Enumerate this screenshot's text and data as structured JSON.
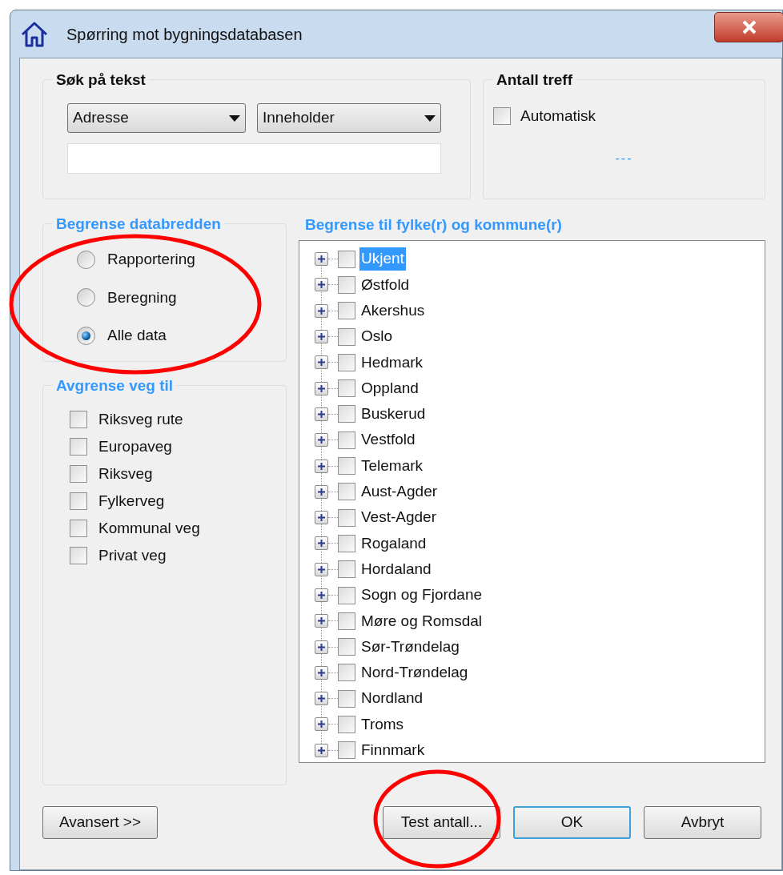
{
  "window": {
    "title": "Spørring mot bygningsdatabasen"
  },
  "search_text": {
    "title": "Søk på tekst",
    "field_dropdown": "Adresse",
    "match_dropdown": "Inneholder"
  },
  "hit_count": {
    "title": "Antall treff",
    "automatic": {
      "label": "Automatisk",
      "checked": false
    },
    "result": "---"
  },
  "data_width": {
    "title": "Begrense databredden",
    "highlighted": true,
    "options": [
      {
        "label": "Rapportering",
        "selected": false
      },
      {
        "label": "Beregning",
        "selected": false
      },
      {
        "label": "Alle data",
        "selected": true
      }
    ]
  },
  "road_filter": {
    "title": "Avgrense veg til",
    "options": [
      {
        "label": "Riksveg rute",
        "checked": false
      },
      {
        "label": "Europaveg",
        "checked": false
      },
      {
        "label": "Riksveg",
        "checked": false
      },
      {
        "label": "Fylkerveg",
        "checked": false
      },
      {
        "label": "Kommunal veg",
        "checked": false
      },
      {
        "label": "Privat veg",
        "checked": false
      }
    ]
  },
  "region_tree": {
    "title": "Begrense til fylke(r) og kommune(r)",
    "items": [
      {
        "label": "Ukjent",
        "checked": false,
        "expanded": false,
        "selected": true
      },
      {
        "label": "Østfold",
        "checked": false,
        "expanded": false,
        "selected": false
      },
      {
        "label": "Akershus",
        "checked": false,
        "expanded": false,
        "selected": false
      },
      {
        "label": "Oslo",
        "checked": false,
        "expanded": false,
        "selected": false
      },
      {
        "label": "Hedmark",
        "checked": false,
        "expanded": false,
        "selected": false
      },
      {
        "label": "Oppland",
        "checked": false,
        "expanded": false,
        "selected": false
      },
      {
        "label": "Buskerud",
        "checked": false,
        "expanded": false,
        "selected": false
      },
      {
        "label": "Vestfold",
        "checked": false,
        "expanded": false,
        "selected": false
      },
      {
        "label": "Telemark",
        "checked": false,
        "expanded": false,
        "selected": false
      },
      {
        "label": "Aust-Agder",
        "checked": false,
        "expanded": false,
        "selected": false
      },
      {
        "label": "Vest-Agder",
        "checked": false,
        "expanded": false,
        "selected": false
      },
      {
        "label": "Rogaland",
        "checked": false,
        "expanded": false,
        "selected": false
      },
      {
        "label": "Hordaland",
        "checked": false,
        "expanded": false,
        "selected": false
      },
      {
        "label": "Sogn og Fjordane",
        "checked": false,
        "expanded": false,
        "selected": false
      },
      {
        "label": "Møre og Romsdal",
        "checked": false,
        "expanded": false,
        "selected": false
      },
      {
        "label": "Sør-Trøndelag",
        "checked": false,
        "expanded": false,
        "selected": false
      },
      {
        "label": "Nord-Trøndelag",
        "checked": false,
        "expanded": false,
        "selected": false
      },
      {
        "label": "Nordland",
        "checked": false,
        "expanded": false,
        "selected": false
      },
      {
        "label": "Troms",
        "checked": false,
        "expanded": false,
        "selected": false
      },
      {
        "label": "Finnmark",
        "checked": false,
        "expanded": false,
        "selected": false
      }
    ]
  },
  "buttons": [
    {
      "label": "Avansert >>",
      "kind": "normal",
      "highlighted": false
    },
    {
      "label": "Test antall...",
      "kind": "normal",
      "highlighted": true
    },
    {
      "label": "OK",
      "kind": "default",
      "highlighted": false
    },
    {
      "label": "Avbryt",
      "kind": "normal",
      "highlighted": false
    }
  ]
}
